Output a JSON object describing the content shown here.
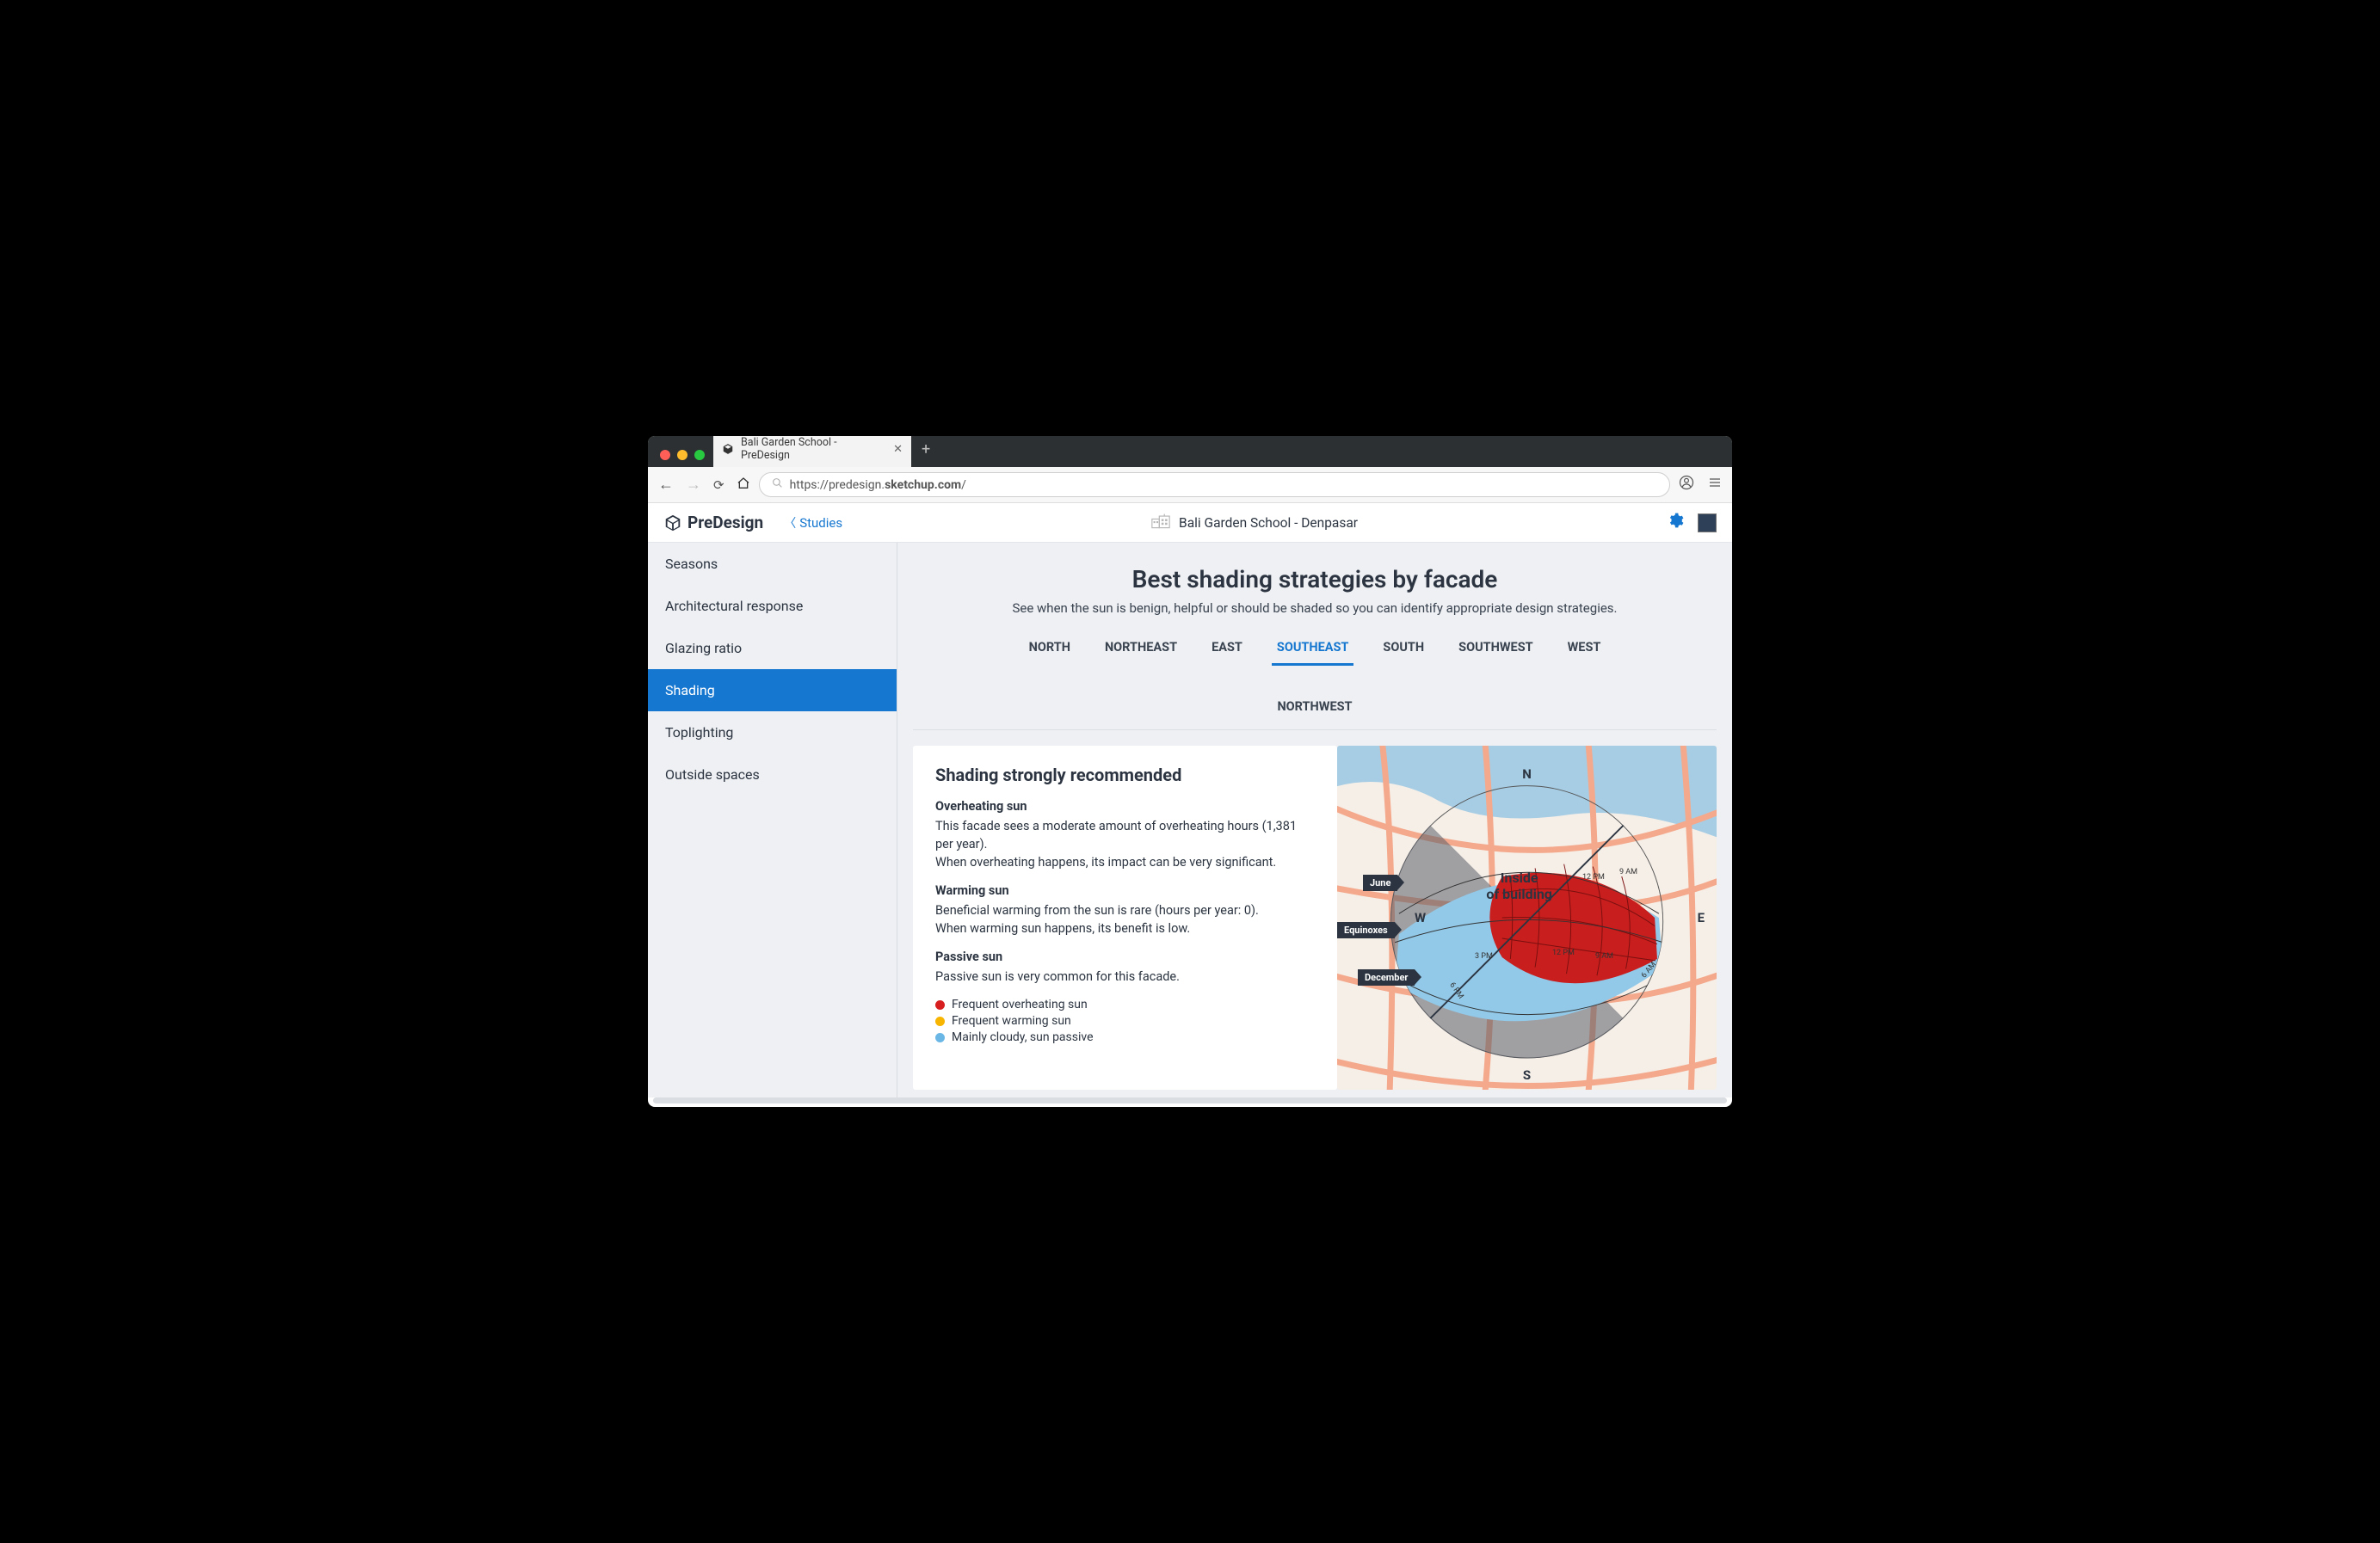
{
  "browser": {
    "tab_title": "Bali Garden School - PreDesign",
    "url_display": "https://predesign.sketchup.com/",
    "url_bold_part": "sketchup.com"
  },
  "header": {
    "product_name": "PreDesign",
    "back_label": "Studies",
    "project_name": "Bali Garden School - Denpasar"
  },
  "sidebar": {
    "items": [
      {
        "label": "Seasons",
        "active": false
      },
      {
        "label": "Architectural response",
        "active": false
      },
      {
        "label": "Glazing ratio",
        "active": false
      },
      {
        "label": "Shading",
        "active": true
      },
      {
        "label": "Toplighting",
        "active": false
      },
      {
        "label": "Outside spaces",
        "active": false
      }
    ]
  },
  "page": {
    "title": "Best shading strategies by facade",
    "subtitle": "See when the sun is benign, helpful or should be shaded so you can identify appropriate design strategies."
  },
  "facade_tabs": [
    {
      "label": "NORTH",
      "active": false
    },
    {
      "label": "NORTHEAST",
      "active": false
    },
    {
      "label": "EAST",
      "active": false
    },
    {
      "label": "SOUTHEAST",
      "active": true
    },
    {
      "label": "SOUTH",
      "active": false
    },
    {
      "label": "SOUTHWEST",
      "active": false
    },
    {
      "label": "WEST",
      "active": false
    },
    {
      "label": "NORTHWEST",
      "active": false
    }
  ],
  "panel": {
    "heading": "Shading strongly recommended",
    "overheating": {
      "title": "Overheating sun",
      "line1": "This facade sees a moderate amount of overheating hours (1,381 per year).",
      "line2": "When overheating happens, its impact can be very significant."
    },
    "warming": {
      "title": "Warming sun",
      "line1": "Beneficial warming from the sun is rare (hours per year: 0).",
      "line2": "When warming sun happens, its benefit is low."
    },
    "passive": {
      "title": "Passive sun",
      "line1": "Passive sun is very common for this facade."
    },
    "legend": [
      {
        "color": "red",
        "label": "Frequent overheating sun"
      },
      {
        "color": "yellow",
        "label": "Frequent warming sun"
      },
      {
        "color": "blue",
        "label": "Mainly cloudy, sun passive"
      }
    ]
  },
  "diagram": {
    "compass_n": "N",
    "compass_s": "S",
    "compass_e": "E",
    "compass_w": "W",
    "inside_line1": "Inside",
    "inside_line2": "of building",
    "tag_june": "June",
    "tag_equinoxes": "Equinoxes",
    "tag_december": "December",
    "time_labels": [
      "6 AM",
      "9 AM",
      "12 PM",
      "3 PM",
      "6 PM",
      "9 AM",
      "12 PM"
    ]
  },
  "colors": {
    "accent": "#1677d0",
    "overheat": "#d71f1f",
    "warm": "#f7b500",
    "passive": "#6ab7e6"
  }
}
